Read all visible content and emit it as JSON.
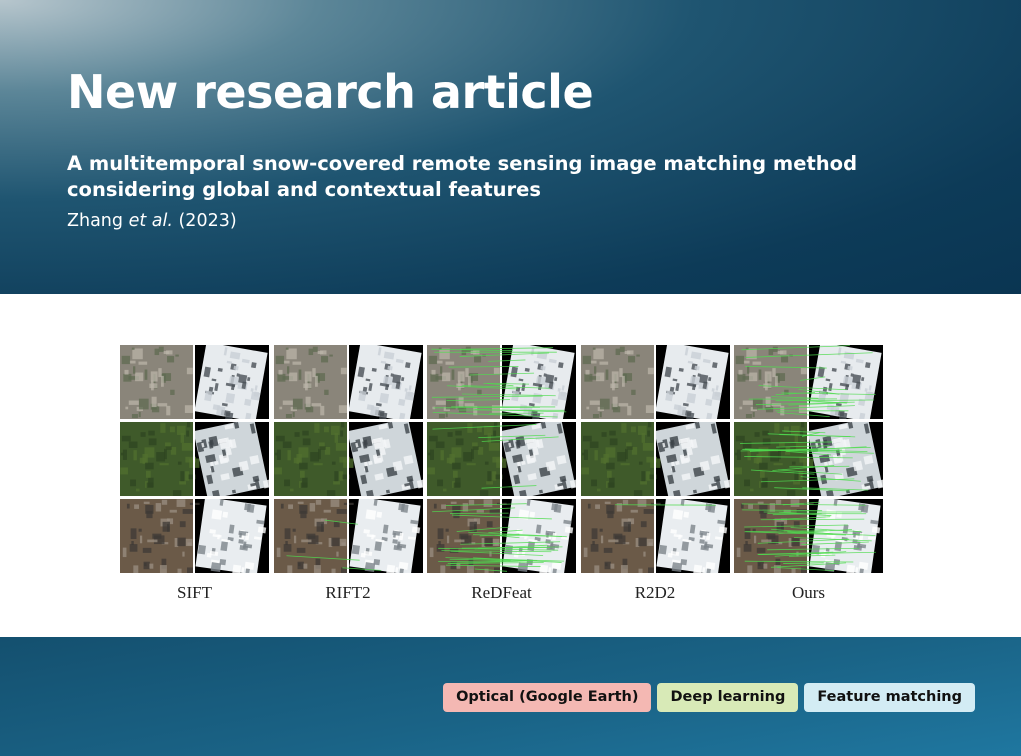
{
  "header": {
    "title": "New research article",
    "subtitle": "A multitemporal snow-covered remote sensing image matching method considering global and contextual features",
    "citation_authors": "Zhang ",
    "citation_etal": "et al.",
    "citation_year": " (2023)"
  },
  "figure": {
    "methods": [
      "SIFT",
      "RIFT2",
      "ReDFeat",
      "R2D2",
      "Ours"
    ],
    "match_line_color": "#4fdc4f",
    "match_density": {
      "SIFT": [
        0,
        0,
        0
      ],
      "RIFT2": [
        0,
        0,
        0.1
      ],
      "ReDFeat": [
        0.7,
        0.15,
        0.9
      ],
      "R2D2": [
        0,
        0,
        0.05
      ],
      "Ours": [
        0.6,
        0.8,
        1.0
      ]
    }
  },
  "tags": [
    {
      "label": "Optical (Google Earth)",
      "color": "#f4b8b3"
    },
    {
      "label": "Deep learning",
      "color": "#d8eab7"
    },
    {
      "label": "Feature matching",
      "color": "#d3ecf4"
    }
  ],
  "colors": {
    "header_dark": "#0d3b58",
    "footer_blue": "#1f77a0"
  }
}
